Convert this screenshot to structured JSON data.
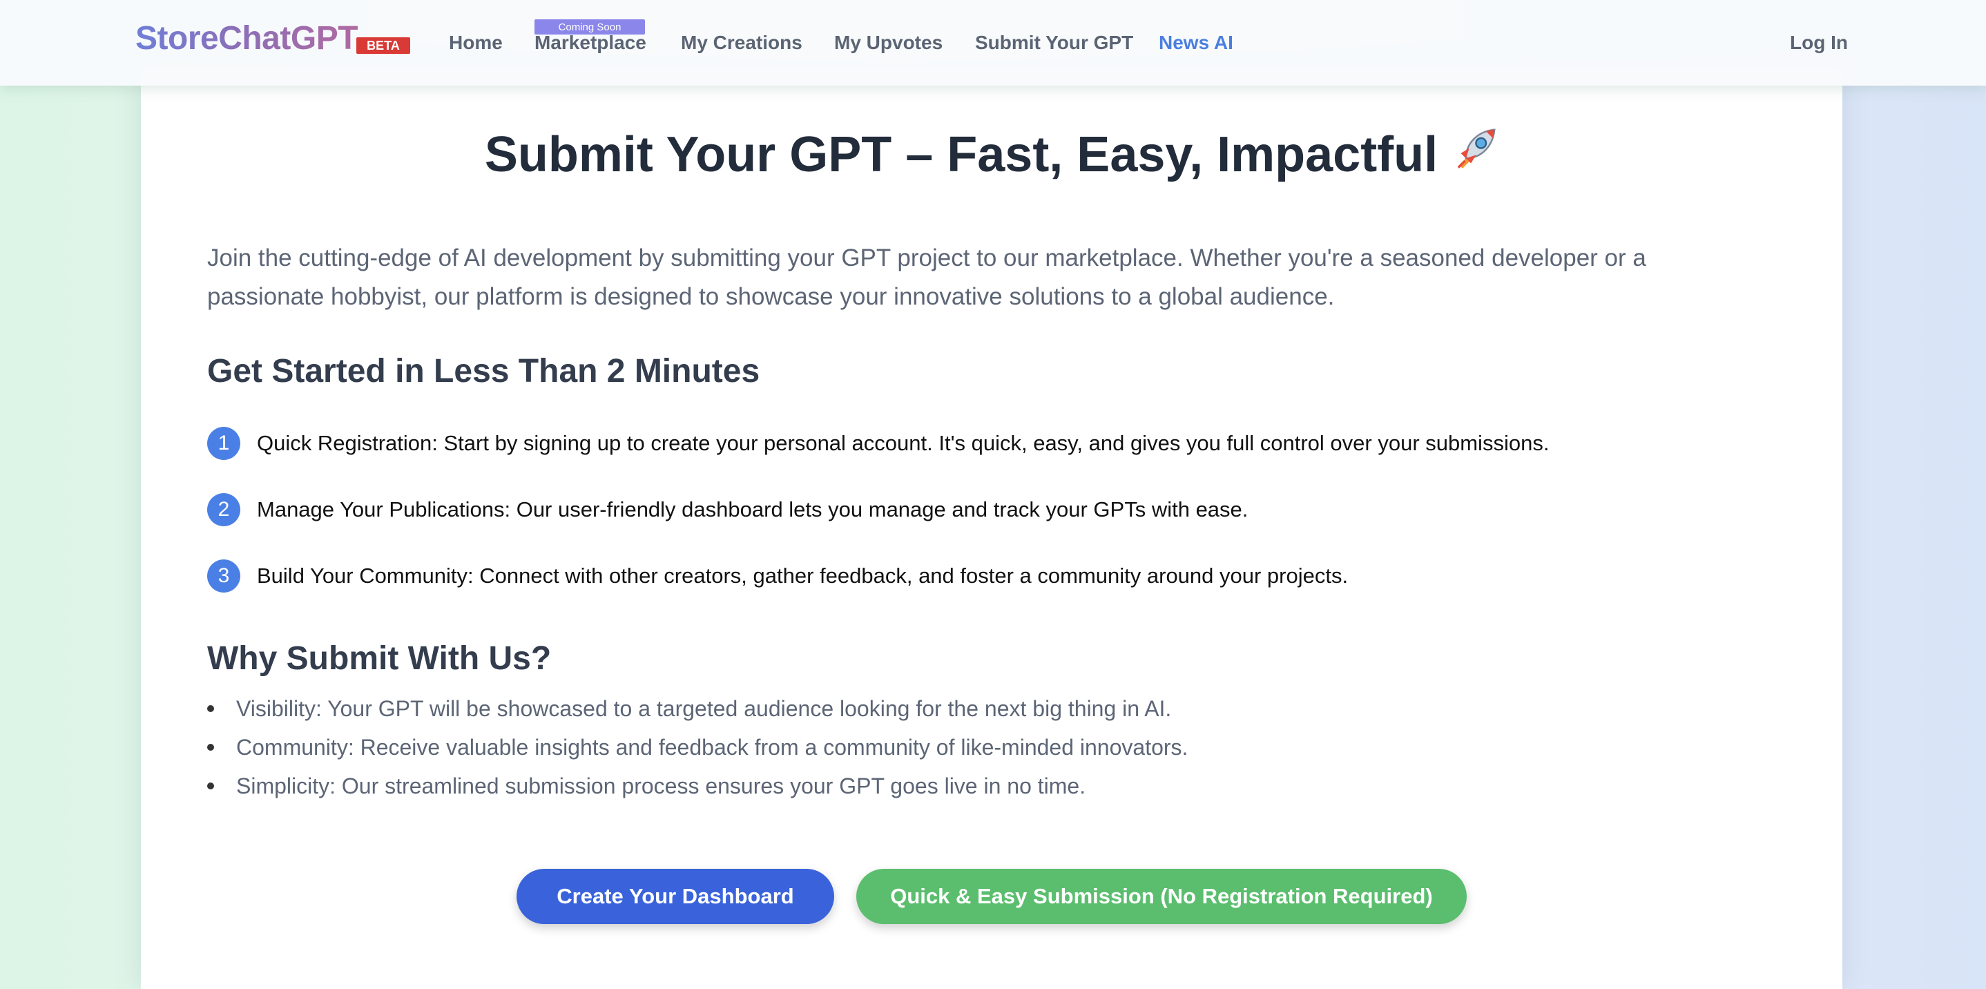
{
  "header": {
    "logo": "StoreChatGPT",
    "badge": "BETA",
    "nav": {
      "home": "Home",
      "marketplace_tag": "Coming Soon",
      "marketplace": "Marketplace",
      "creations": "My Creations",
      "upvotes": "My Upvotes",
      "submit": "Submit Your GPT",
      "news": "News AI"
    },
    "login": "Log In"
  },
  "main": {
    "title": "Submit Your GPT – Fast, Easy, Impactful",
    "title_icon": "rocket-icon",
    "intro": "Join the cutting-edge of AI development by submitting your GPT project to our marketplace. Whether you're a seasoned developer or a passionate hobbyist, our platform is designed to showcase your innovative solutions to a global audience.",
    "steps_heading": "Get Started in Less Than 2 Minutes",
    "steps": [
      {
        "num": "1",
        "text": "Quick Registration: Start by signing up to create your personal account. It's quick, easy, and gives you full control over your submissions."
      },
      {
        "num": "2",
        "text": "Manage Your Publications: Our user-friendly dashboard lets you manage and track your GPTs with ease."
      },
      {
        "num": "3",
        "text": "Build Your Community: Connect with other creators, gather feedback, and foster a community around your projects."
      }
    ],
    "why_heading": "Why Submit With Us?",
    "reasons": [
      "Visibility: Your GPT will be showcased to a targeted audience looking for the next big thing in AI.",
      "Community: Receive valuable insights and feedback from a community of like-minded innovators.",
      "Simplicity: Our streamlined submission process ensures your GPT goes live in no time."
    ],
    "buttons": {
      "dashboard": "Create Your Dashboard",
      "quick": "Quick & Easy Submission (No Registration Required)"
    }
  },
  "colors": {
    "primary_blue": "#3a63db",
    "success_green": "#5bbe6e",
    "beta_red": "#d93a35",
    "nav_accent": "#4a7fe0",
    "coming_soon": "#8b86ea"
  }
}
